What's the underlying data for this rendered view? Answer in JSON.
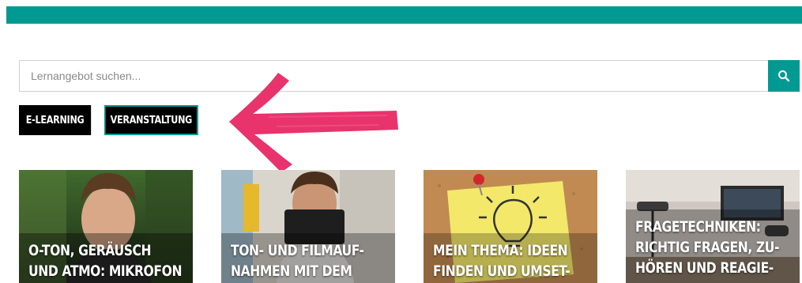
{
  "header": {
    "accent_color": "#009a92"
  },
  "search": {
    "placeholder": "Lernangebot suchen...",
    "icon": "search-icon"
  },
  "filters": [
    {
      "label": "E-LEARNING"
    },
    {
      "label": "VERANSTALTUNG"
    }
  ],
  "annotation": {
    "icon": "arrow-left-icon",
    "color": "#e8336d"
  },
  "cards": [
    {
      "title": "O-TON, GERÄUSCH\nUND ATMO: MIKROFON"
    },
    {
      "title": "TON- UND FILMAUF-\nNAHMEN MIT DEM"
    },
    {
      "title": "MEIN THEMA: IDEEN\nFINDEN UND UMSET-"
    },
    {
      "title": "FRAGETECHNIKEN:\nRICHTIG FRAGEN, ZU-\nHÖREN UND REAGIE-"
    }
  ]
}
